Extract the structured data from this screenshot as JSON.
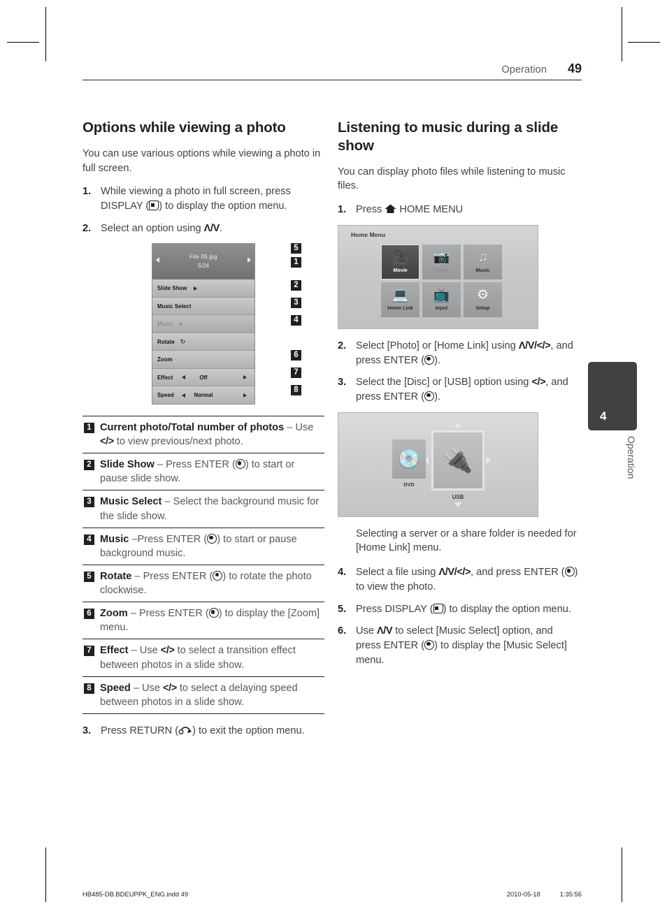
{
  "header": {
    "section": "Operation",
    "page_number": "49"
  },
  "left_column": {
    "title": "Options while viewing a photo",
    "intro": "You can use various options while viewing a photo in full screen.",
    "steps": [
      {
        "num": "1.",
        "text_before": "While viewing a photo in full screen, press DISPLAY (",
        "icon": "display-icon",
        "text_after": ") to display the option menu."
      },
      {
        "num": "2.",
        "text_before": "Select an option using ",
        "arrows": "Λ/V",
        "text_after": "."
      }
    ],
    "option_menu": {
      "file_name": "File 05.jpg",
      "file_count": "5/24",
      "rows": [
        {
          "label": "Slide Show",
          "widget": "play",
          "value": ""
        },
        {
          "label": "Music Select",
          "widget": "none",
          "value": ""
        },
        {
          "label": "Music",
          "widget": "play",
          "value": "",
          "dimmed": true
        },
        {
          "label": "Rotate",
          "widget": "rotate",
          "value": ""
        },
        {
          "label": "Zoom",
          "widget": "none",
          "value": ""
        },
        {
          "label": "Effect",
          "widget": "spin",
          "value": "Off"
        },
        {
          "label": "Speed",
          "widget": "spin",
          "value": "Normal"
        }
      ],
      "callouts": [
        "1",
        "2",
        "3",
        "4",
        "5",
        "6",
        "7",
        "8"
      ]
    },
    "legend": [
      {
        "num": "1",
        "bold": "Current photo/Total number of photos",
        "rest_a": " – Use ",
        "arrows": "</>",
        "rest_b": " to view previous/next photo."
      },
      {
        "num": "2",
        "bold": "Slide Show",
        "rest_a": " – Press ENTER (",
        "icon": "enter-icon",
        "rest_b": ") to start or pause slide show."
      },
      {
        "num": "3",
        "bold": "Music Select",
        "rest_a": " – Select the background music for the slide show.",
        "rest_b": ""
      },
      {
        "num": "4",
        "bold": "Music",
        "rest_a": " –Press ENTER (",
        "icon": "enter-icon",
        "rest_b": ") to start or pause background music."
      },
      {
        "num": "5",
        "bold": "Rotate",
        "rest_a": " – Press ENTER (",
        "icon": "enter-icon",
        "rest_b": ") to rotate the photo clockwise."
      },
      {
        "num": "6",
        "bold": "Zoom",
        "rest_a": " – Press ENTER (",
        "icon": "enter-icon",
        "rest_b": ") to display the [Zoom] menu."
      },
      {
        "num": "7",
        "bold": "Effect",
        "rest_a": " – Use ",
        "arrows": "</>",
        "rest_b": " to select a transition effect between photos in a slide show."
      },
      {
        "num": "8",
        "bold": "Speed",
        "rest_a": " – Use ",
        "arrows": "</>",
        "rest_b": " to select a delaying speed between photos in a slide show."
      }
    ],
    "final_step": {
      "num": "3.",
      "text_before": "Press RETURN (",
      "icon": "return-icon",
      "text_after": ") to exit the option menu."
    }
  },
  "right_column": {
    "title": "Listening to music during a slide show",
    "intro": "You can display photo files while listening to music files.",
    "step1": {
      "num": "1.",
      "text_before": "Press ",
      "icon": "home-icon",
      "text_after": " HOME MENU"
    },
    "home_menu": {
      "title": "Home Menu",
      "tiles": [
        {
          "label": "Movie",
          "icon": "film-reel-icon",
          "glyph": "◉",
          "state": "selected"
        },
        {
          "label": "Photo",
          "icon": "photo-icon",
          "glyph": "ὛC",
          "state": "faded"
        },
        {
          "label": "Music",
          "icon": "music-note-icon",
          "glyph": "♫",
          "state": "normal"
        },
        {
          "label": "Home Link",
          "icon": "monitor-icon",
          "glyph": "▣",
          "state": "normal"
        },
        {
          "label": "Input",
          "icon": "input-icon",
          "glyph": "◐",
          "state": "normal"
        },
        {
          "label": "Setup",
          "icon": "gear-icon",
          "glyph": "⚙",
          "state": "normal"
        }
      ]
    },
    "step2": {
      "num": "2.",
      "text_before": "Select [Photo] or [Home Link] using ",
      "arrows": "Λ/V/</>",
      "text_mid": ", and press ENTER (",
      "icon": "enter-icon",
      "text_after": ")."
    },
    "step3": {
      "num": "3.",
      "text_before": "Select the [Disc] or [USB] option using ",
      "arrows": "</>",
      "text_mid": ", and press ENTER (",
      "icon": "enter-icon",
      "text_after": ")."
    },
    "source_screen": {
      "disc_label": "DVD",
      "usb_label": "USB",
      "disc_icon": "disc-icon",
      "usb_icon": "usb-plug-icon"
    },
    "note": "Selecting a server or a share folder is needed for [Home Link] menu.",
    "step4": {
      "num": "4.",
      "text_before": "Select a file using ",
      "arrows": "Λ/V/</>",
      "text_mid": ", and press ENTER (",
      "icon": "enter-icon",
      "text_after": ") to view the photo."
    },
    "step5": {
      "num": "5.",
      "text_before": "Press DISPLAY (",
      "icon": "display-icon",
      "text_after": ") to display the option menu."
    },
    "step6": {
      "num": "6.",
      "text_before": "Use ",
      "arrows": "Λ/V",
      "text_mid": " to select [Music Select] option, and press ENTER (",
      "icon": "enter-icon",
      "text_after": ") to display the [Music Select] menu."
    }
  },
  "side_tab": {
    "number": "4",
    "label": "Operation"
  },
  "footer": {
    "file_name": "HB485-DB.BDEUPPK_ENG.indd   49",
    "date": "2010-05-18",
    "time": "1:35:56"
  }
}
